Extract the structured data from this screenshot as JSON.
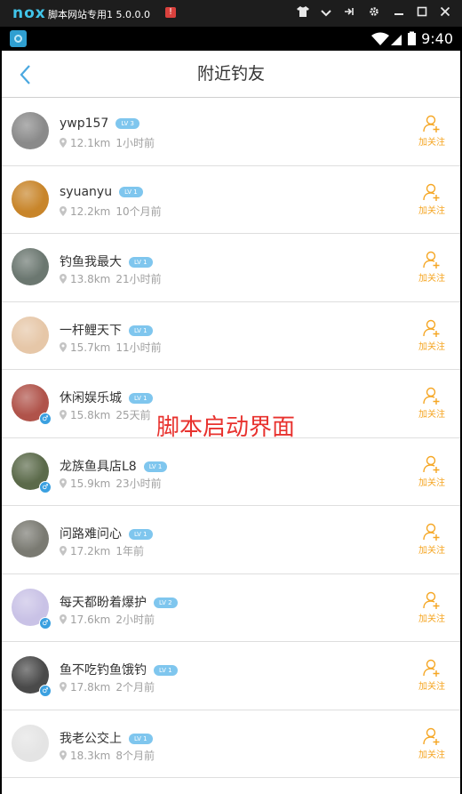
{
  "emulator": {
    "logo": "nox",
    "title": "脚本网站专用1 5.0.0.0",
    "badge": "!"
  },
  "status_bar": {
    "time": "9:40"
  },
  "nav": {
    "title": "附近钓友"
  },
  "overlay_text": "脚本启动界面",
  "follow_label": "加关注",
  "users": [
    {
      "name": "ywp157",
      "level": "LV 3",
      "distance": "12.1km",
      "time": "1小时前",
      "avatar_color": "#8a8a8a",
      "gender": ""
    },
    {
      "name": "syuanyu",
      "level": "LV 1",
      "distance": "12.2km",
      "time": "10个月前",
      "avatar_color": "#c8852a",
      "gender": ""
    },
    {
      "name": "钓鱼我最大",
      "level": "LV 1",
      "distance": "13.8km",
      "time": "21小时前",
      "avatar_color": "#6b7770",
      "gender": ""
    },
    {
      "name": "一杆鲤天下",
      "level": "LV 1",
      "distance": "15.7km",
      "time": "11小时前",
      "avatar_color": "#e6c7a8",
      "gender": ""
    },
    {
      "name": "休闲娱乐城",
      "level": "LV 1",
      "distance": "15.8km",
      "time": "25天前",
      "avatar_color": "#b0534a",
      "gender": "♂"
    },
    {
      "name": "龙族鱼具店L8",
      "level": "LV 1",
      "distance": "15.9km",
      "time": "23小时前",
      "avatar_color": "#5b6a4a",
      "gender": "♂"
    },
    {
      "name": "问路难问心",
      "level": "LV 1",
      "distance": "17.2km",
      "time": "1年前",
      "avatar_color": "#7a7a72",
      "gender": ""
    },
    {
      "name": "每天都盼着爆护",
      "level": "LV 2",
      "distance": "17.6km",
      "time": "2小时前",
      "avatar_color": "#c9c2e6",
      "gender": "♂"
    },
    {
      "name": "鱼不吃钓鱼饿钓",
      "level": "LV 1",
      "distance": "17.8km",
      "time": "2个月前",
      "avatar_color": "#4a4a4a",
      "gender": "♂"
    },
    {
      "name": "我老公交上",
      "level": "LV 1",
      "distance": "18.3km",
      "time": "8个月前",
      "avatar_color": "#e4e4e4",
      "gender": ""
    }
  ],
  "colors": {
    "accent": "#f5a623",
    "level_badge": "#7fc6ee",
    "back_arrow": "#4aa8e0",
    "overlay": "#e8322e"
  }
}
